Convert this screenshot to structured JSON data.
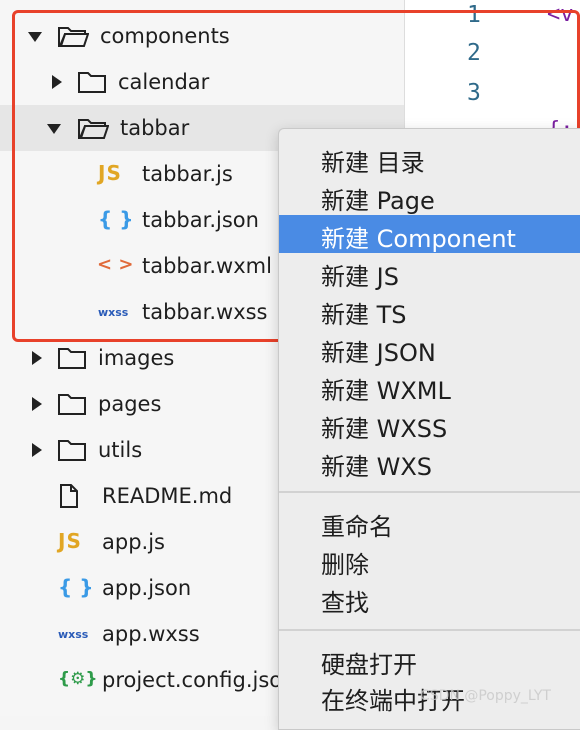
{
  "explorer": {
    "tree": [
      {
        "label": "components",
        "type": "folder",
        "expanded": true,
        "level": 0
      },
      {
        "label": "calendar",
        "type": "folder",
        "expanded": false,
        "level": 1
      },
      {
        "label": "tabbar",
        "type": "folder",
        "expanded": true,
        "level": 1
      },
      {
        "label": "tabbar.js",
        "type": "js",
        "level": 2
      },
      {
        "label": "tabbar.json",
        "type": "json",
        "level": 2
      },
      {
        "label": "tabbar.wxml",
        "type": "wxml",
        "level": 2
      },
      {
        "label": "tabbar.wxss",
        "type": "wxss",
        "level": 2
      },
      {
        "label": "images",
        "type": "folder",
        "expanded": false,
        "level": 0
      },
      {
        "label": "pages",
        "type": "folder",
        "expanded": false,
        "level": 0
      },
      {
        "label": "utils",
        "type": "folder",
        "expanded": false,
        "level": 0
      },
      {
        "label": "README.md",
        "type": "md",
        "level": 0
      },
      {
        "label": "app.js",
        "type": "js",
        "level": 0
      },
      {
        "label": "app.json",
        "type": "json",
        "level": 0
      },
      {
        "label": "app.wxss",
        "type": "wxss",
        "level": 0
      },
      {
        "label": "project.config.jso",
        "type": "config",
        "level": 0
      }
    ],
    "icons": {
      "js": "JS",
      "json": "{ }",
      "wxml": "< >",
      "wxss": "wxss",
      "config": "{⚙}"
    }
  },
  "editor": {
    "line_numbers": [
      "1",
      "2",
      "3"
    ],
    "fragments": [
      "<v",
      "{:",
      "<",
      "v"
    ]
  },
  "context_menu": {
    "items": [
      "新建 目录",
      "新建 Page",
      "新建 Component",
      "新建 JS",
      "新建 TS",
      "新建 JSON",
      "新建 WXML",
      "新建 WXSS",
      "新建 WXS"
    ],
    "selected_index": 2,
    "group2": [
      "重命名",
      "删除",
      "查找"
    ],
    "group3": [
      "硬盘打开",
      "在终端中打开"
    ]
  },
  "watermark": "CSDN @Poppy_LYT",
  "colors": {
    "selection": "#4a8be4",
    "outline": "#e8412a",
    "js_icon": "#e1a624",
    "json_icon": "#3a9ae6",
    "wxml_icon": "#e06a3a",
    "wxss_icon": "#2a5bb8",
    "config_icon": "#2e9b4a"
  }
}
